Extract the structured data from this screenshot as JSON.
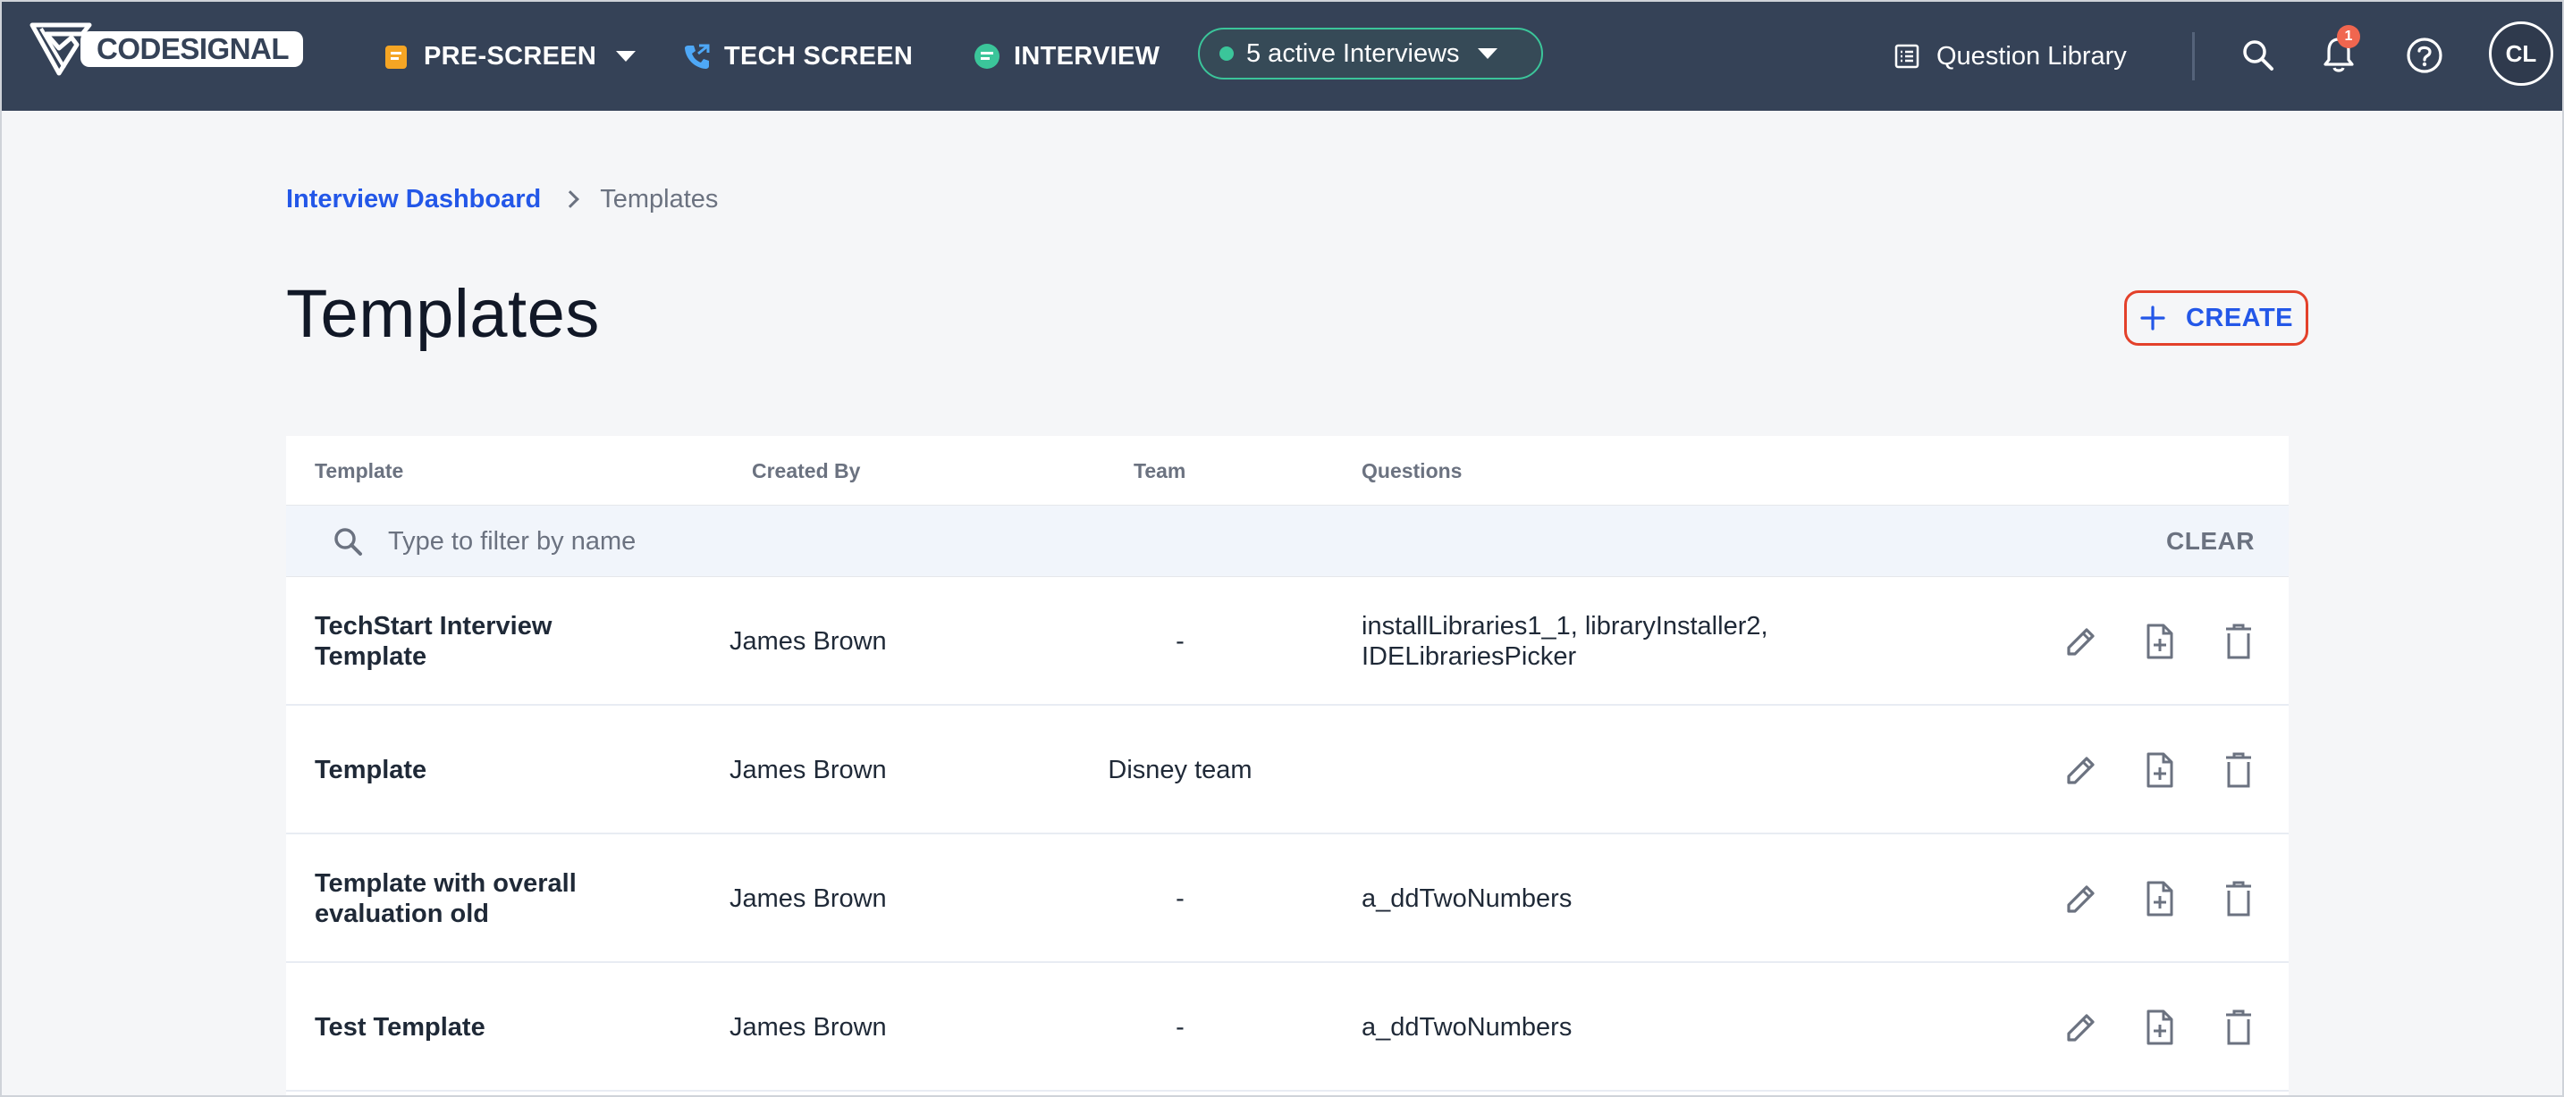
{
  "nav": {
    "logo_text": "CODESIGNAL",
    "pre_screen": "PRE-SCREEN",
    "tech_screen": "TECH SCREEN",
    "interview": "INTERVIEW",
    "active_interviews": "5 active Interviews",
    "question_library": "Question Library",
    "notifications_count": "1",
    "avatar_initials": "CL",
    "colors": {
      "bar": "#354257",
      "active_green": "#3bc59a",
      "badge": "#f0664f"
    }
  },
  "breadcrumb": {
    "parent": "Interview Dashboard",
    "current": "Templates"
  },
  "page": {
    "title": "Templates",
    "create_label": "CREATE"
  },
  "table": {
    "headers": {
      "template": "Template",
      "created_by": "Created By",
      "team": "Team",
      "questions": "Questions"
    },
    "filter": {
      "placeholder": "Type to filter by name",
      "value": "",
      "clear_label": "CLEAR"
    },
    "rows": [
      {
        "name_line1": "TechStart Interview",
        "name_line2": "Template",
        "created_by": "James Brown",
        "team": "-",
        "questions_line1": "installLibraries1_1, libraryInstaller2,",
        "questions_line2": "IDELibrariesPicker"
      },
      {
        "name_line1": "Template",
        "name_line2": "",
        "created_by": "James Brown",
        "team": "Disney team",
        "questions_line1": "",
        "questions_line2": ""
      },
      {
        "name_line1": "Template with overall",
        "name_line2": "evaluation old",
        "created_by": "James Brown",
        "team": "-",
        "questions_line1": "a_ddTwoNumbers",
        "questions_line2": ""
      },
      {
        "name_line1": "Test Template",
        "name_line2": "",
        "created_by": "James Brown",
        "team": "-",
        "questions_line1": "a_ddTwoNumbers",
        "questions_line2": ""
      }
    ],
    "row_actions": [
      "edit-icon",
      "duplicate-icon",
      "delete-icon"
    ]
  },
  "accent": {
    "link_blue": "#2357e8",
    "highlight_red": "#e3412b"
  }
}
